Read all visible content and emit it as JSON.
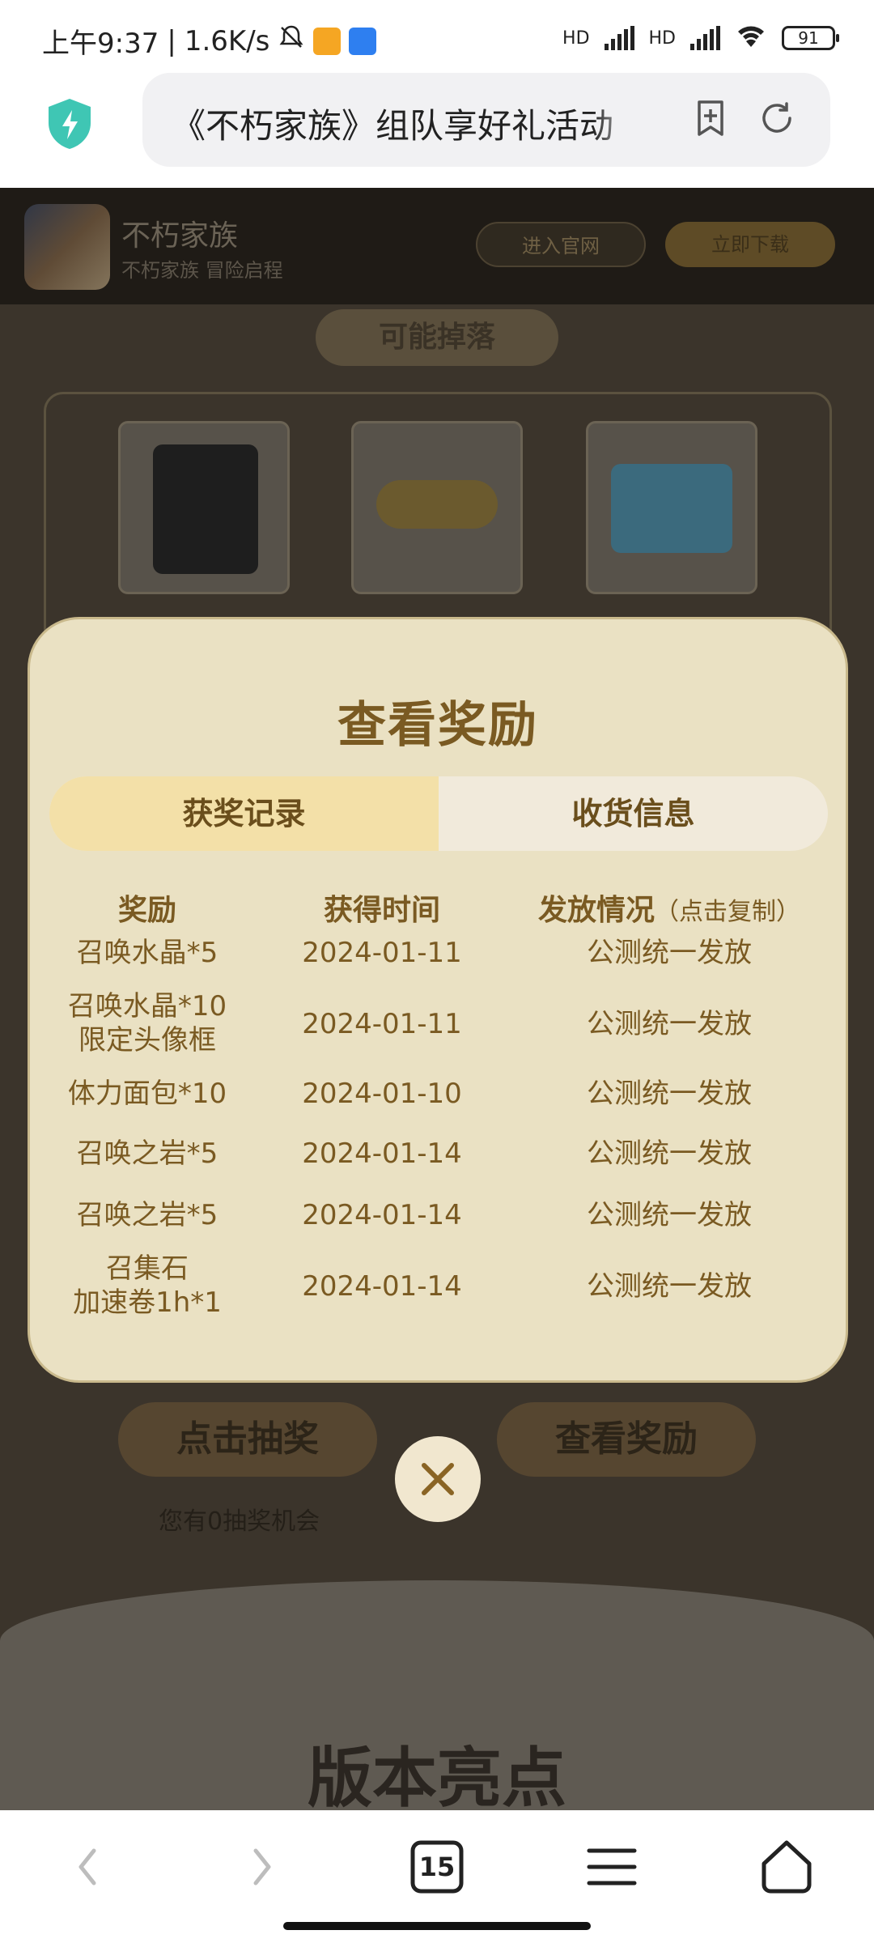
{
  "status_bar": {
    "time": "上午9:37",
    "net_speed": "1.6K/s",
    "battery": "91",
    "hd1": "HD",
    "hd2": "HD"
  },
  "browser": {
    "url_title": "《不朽家族》组队享好礼活动",
    "tab_count": "15"
  },
  "page": {
    "app_name": "不朽家族",
    "app_subtitle": "不朽家族 冒险启程",
    "official_site_label": "进入官网",
    "download_label": "立即下载",
    "drop_title": "可能掉落",
    "draw_button_label": "点击抽奖",
    "view_rewards_button_label": "查看奖励",
    "chance_text": "您有0抽奖机会",
    "section_title": "版本亮点"
  },
  "modal": {
    "title": "查看奖励",
    "tabs": [
      {
        "label": "获奖记录",
        "active": true
      },
      {
        "label": "收货信息",
        "active": false
      }
    ],
    "columns": {
      "reward": "奖励",
      "time": "获得时间",
      "status": "发放情况",
      "status_hint": "（点击复制）"
    },
    "rows": [
      {
        "reward": "召唤水晶*5",
        "reward2": "",
        "time": "2024-01-11",
        "status": "公测统一发放"
      },
      {
        "reward": "召唤水晶*10",
        "reward2": "限定头像框",
        "time": "2024-01-11",
        "status": "公测统一发放"
      },
      {
        "reward": "体力面包*10",
        "reward2": "",
        "time": "2024-01-10",
        "status": "公测统一发放"
      },
      {
        "reward": "召唤之岩*5",
        "reward2": "",
        "time": "2024-01-14",
        "status": "公测统一发放"
      },
      {
        "reward": "召唤之岩*5",
        "reward2": "",
        "time": "2024-01-14",
        "status": "公测统一发放"
      },
      {
        "reward": "召集石",
        "reward2": "加速卷1h*1",
        "time": "2024-01-14",
        "status": "公测统一发放"
      }
    ]
  },
  "colors": {
    "accent": "#7a5a22",
    "modal_bg": "#eae1c3",
    "active_tab": "#f3e0a8",
    "shield": "#3fc6b4"
  }
}
